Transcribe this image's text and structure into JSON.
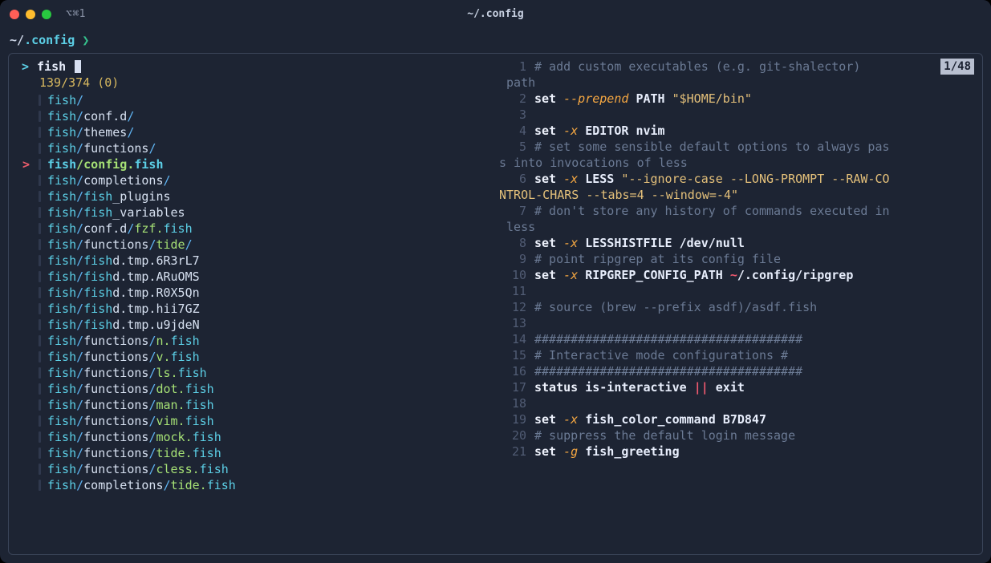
{
  "titlebar": {
    "tab_label": "⌥⌘1",
    "window_title": "~/.config"
  },
  "prompt": {
    "prefix": "~/",
    "dir": ".config",
    "symbol": "❯"
  },
  "fzf": {
    "query": "fish",
    "counts": "139/374 (0)",
    "preview_badge": "1/48",
    "selected_index": 4,
    "items": [
      [
        {
          "t": "fish",
          "c": "cyan"
        },
        {
          "t": "/",
          "c": "blue"
        }
      ],
      [
        {
          "t": "fish",
          "c": "cyan"
        },
        {
          "t": "/",
          "c": "blue"
        },
        {
          "t": "conf.d",
          "c": "text"
        },
        {
          "t": "/",
          "c": "blue"
        }
      ],
      [
        {
          "t": "fish",
          "c": "cyan"
        },
        {
          "t": "/",
          "c": "blue"
        },
        {
          "t": "themes",
          "c": "text"
        },
        {
          "t": "/",
          "c": "blue"
        }
      ],
      [
        {
          "t": "fish",
          "c": "cyan"
        },
        {
          "t": "/",
          "c": "blue"
        },
        {
          "t": "functions",
          "c": "text"
        },
        {
          "t": "/",
          "c": "blue"
        }
      ],
      [
        {
          "t": "fish",
          "c": "cyan"
        },
        {
          "t": "/",
          "c": "green"
        },
        {
          "t": "config.",
          "c": "green"
        },
        {
          "t": "fish",
          "c": "cyan"
        }
      ],
      [
        {
          "t": "fish",
          "c": "cyan"
        },
        {
          "t": "/",
          "c": "blue"
        },
        {
          "t": "completions",
          "c": "text"
        },
        {
          "t": "/",
          "c": "blue"
        }
      ],
      [
        {
          "t": "fish",
          "c": "cyan"
        },
        {
          "t": "/",
          "c": "blue"
        },
        {
          "t": "fish",
          "c": "cyan"
        },
        {
          "t": "_plugins",
          "c": "text"
        }
      ],
      [
        {
          "t": "fish",
          "c": "cyan"
        },
        {
          "t": "/",
          "c": "blue"
        },
        {
          "t": "fish",
          "c": "cyan"
        },
        {
          "t": "_variables",
          "c": "text"
        }
      ],
      [
        {
          "t": "fish",
          "c": "cyan"
        },
        {
          "t": "/",
          "c": "blue"
        },
        {
          "t": "conf.d",
          "c": "text"
        },
        {
          "t": "/",
          "c": "blue"
        },
        {
          "t": "fzf.",
          "c": "green"
        },
        {
          "t": "fish",
          "c": "cyan"
        }
      ],
      [
        {
          "t": "fish",
          "c": "cyan"
        },
        {
          "t": "/",
          "c": "blue"
        },
        {
          "t": "functions",
          "c": "text"
        },
        {
          "t": "/",
          "c": "blue"
        },
        {
          "t": "tide",
          "c": "green"
        },
        {
          "t": "/",
          "c": "blue"
        }
      ],
      [
        {
          "t": "fish",
          "c": "cyan"
        },
        {
          "t": "/",
          "c": "blue"
        },
        {
          "t": "fish",
          "c": "cyan"
        },
        {
          "t": "d.tmp.6R3rL7",
          "c": "text"
        }
      ],
      [
        {
          "t": "fish",
          "c": "cyan"
        },
        {
          "t": "/",
          "c": "blue"
        },
        {
          "t": "fish",
          "c": "cyan"
        },
        {
          "t": "d.tmp.ARuOMS",
          "c": "text"
        }
      ],
      [
        {
          "t": "fish",
          "c": "cyan"
        },
        {
          "t": "/",
          "c": "blue"
        },
        {
          "t": "fish",
          "c": "cyan"
        },
        {
          "t": "d.tmp.R0X5Qn",
          "c": "text"
        }
      ],
      [
        {
          "t": "fish",
          "c": "cyan"
        },
        {
          "t": "/",
          "c": "blue"
        },
        {
          "t": "fish",
          "c": "cyan"
        },
        {
          "t": "d.tmp.hii7GZ",
          "c": "text"
        }
      ],
      [
        {
          "t": "fish",
          "c": "cyan"
        },
        {
          "t": "/",
          "c": "blue"
        },
        {
          "t": "fish",
          "c": "cyan"
        },
        {
          "t": "d.tmp.u9jdeN",
          "c": "text"
        }
      ],
      [
        {
          "t": "fish",
          "c": "cyan"
        },
        {
          "t": "/",
          "c": "blue"
        },
        {
          "t": "functions",
          "c": "text"
        },
        {
          "t": "/",
          "c": "blue"
        },
        {
          "t": "n.",
          "c": "green"
        },
        {
          "t": "fish",
          "c": "cyan"
        }
      ],
      [
        {
          "t": "fish",
          "c": "cyan"
        },
        {
          "t": "/",
          "c": "blue"
        },
        {
          "t": "functions",
          "c": "text"
        },
        {
          "t": "/",
          "c": "blue"
        },
        {
          "t": "v.",
          "c": "green"
        },
        {
          "t": "fish",
          "c": "cyan"
        }
      ],
      [
        {
          "t": "fish",
          "c": "cyan"
        },
        {
          "t": "/",
          "c": "blue"
        },
        {
          "t": "functions",
          "c": "text"
        },
        {
          "t": "/",
          "c": "blue"
        },
        {
          "t": "ls.",
          "c": "green"
        },
        {
          "t": "fish",
          "c": "cyan"
        }
      ],
      [
        {
          "t": "fish",
          "c": "cyan"
        },
        {
          "t": "/",
          "c": "blue"
        },
        {
          "t": "functions",
          "c": "text"
        },
        {
          "t": "/",
          "c": "blue"
        },
        {
          "t": "dot.",
          "c": "green"
        },
        {
          "t": "fish",
          "c": "cyan"
        }
      ],
      [
        {
          "t": "fish",
          "c": "cyan"
        },
        {
          "t": "/",
          "c": "blue"
        },
        {
          "t": "functions",
          "c": "text"
        },
        {
          "t": "/",
          "c": "blue"
        },
        {
          "t": "man.",
          "c": "green"
        },
        {
          "t": "fish",
          "c": "cyan"
        }
      ],
      [
        {
          "t": "fish",
          "c": "cyan"
        },
        {
          "t": "/",
          "c": "blue"
        },
        {
          "t": "functions",
          "c": "text"
        },
        {
          "t": "/",
          "c": "blue"
        },
        {
          "t": "vim.",
          "c": "green"
        },
        {
          "t": "fish",
          "c": "cyan"
        }
      ],
      [
        {
          "t": "fish",
          "c": "cyan"
        },
        {
          "t": "/",
          "c": "blue"
        },
        {
          "t": "functions",
          "c": "text"
        },
        {
          "t": "/",
          "c": "blue"
        },
        {
          "t": "mock.",
          "c": "green"
        },
        {
          "t": "fish",
          "c": "cyan"
        }
      ],
      [
        {
          "t": "fish",
          "c": "cyan"
        },
        {
          "t": "/",
          "c": "blue"
        },
        {
          "t": "functions",
          "c": "text"
        },
        {
          "t": "/",
          "c": "blue"
        },
        {
          "t": "tide.",
          "c": "green"
        },
        {
          "t": "fish",
          "c": "cyan"
        }
      ],
      [
        {
          "t": "fish",
          "c": "cyan"
        },
        {
          "t": "/",
          "c": "blue"
        },
        {
          "t": "functions",
          "c": "text"
        },
        {
          "t": "/",
          "c": "blue"
        },
        {
          "t": "cless.",
          "c": "green"
        },
        {
          "t": "fish",
          "c": "cyan"
        }
      ],
      [
        {
          "t": "fish",
          "c": "cyan"
        },
        {
          "t": "/",
          "c": "blue"
        },
        {
          "t": "completions",
          "c": "text"
        },
        {
          "t": "/",
          "c": "blue"
        },
        {
          "t": "tide.",
          "c": "green"
        },
        {
          "t": "fish",
          "c": "cyan"
        }
      ]
    ],
    "preview": {
      "wraps": {
        "1": " path",
        "5": "s into invocations of less",
        "6": "NTROL-CHARS --tabs=4 --window=-4\"",
        "7": " less"
      },
      "lines": [
        {
          "n": 1,
          "tokens": [
            {
              "t": "# add custom executables (e.g. git-shalector)",
              "c": "comment"
            }
          ]
        },
        {
          "n": 2,
          "tokens": [
            {
              "t": "set",
              "c": "cmd"
            },
            {
              "t": " "
            },
            {
              "t": "--prepend",
              "c": "flag"
            },
            {
              "t": " "
            },
            {
              "t": "PATH",
              "c": "var"
            },
            {
              "t": " "
            },
            {
              "t": "\"$HOME",
              "c": "str"
            },
            {
              "t": "/bin",
              "c": "str"
            },
            {
              "t": "\"",
              "c": "str"
            }
          ]
        },
        {
          "n": 3,
          "tokens": []
        },
        {
          "n": 4,
          "tokens": [
            {
              "t": "set",
              "c": "cmd"
            },
            {
              "t": " "
            },
            {
              "t": "-x",
              "c": "flag"
            },
            {
              "t": " "
            },
            {
              "t": "EDITOR",
              "c": "var"
            },
            {
              "t": " "
            },
            {
              "t": "nvim",
              "c": "path"
            }
          ]
        },
        {
          "n": 5,
          "tokens": [
            {
              "t": "# set some sensible default options to always pas",
              "c": "comment"
            }
          ]
        },
        {
          "n": 6,
          "tokens": [
            {
              "t": "set",
              "c": "cmd"
            },
            {
              "t": " "
            },
            {
              "t": "-x",
              "c": "flag"
            },
            {
              "t": " "
            },
            {
              "t": "LESS",
              "c": "var"
            },
            {
              "t": " "
            },
            {
              "t": "\"--ignore-case --LONG-PROMPT --RAW-CO",
              "c": "str"
            }
          ]
        },
        {
          "n": 7,
          "tokens": [
            {
              "t": "# don't store any history of commands executed in",
              "c": "comment"
            }
          ]
        },
        {
          "n": 8,
          "tokens": [
            {
              "t": "set",
              "c": "cmd"
            },
            {
              "t": " "
            },
            {
              "t": "-x",
              "c": "flag"
            },
            {
              "t": " "
            },
            {
              "t": "LESSHISTFILE",
              "c": "var"
            },
            {
              "t": " "
            },
            {
              "t": "/dev/null",
              "c": "path"
            }
          ]
        },
        {
          "n": 9,
          "tokens": [
            {
              "t": "# point ripgrep at its config file",
              "c": "comment"
            }
          ]
        },
        {
          "n": 10,
          "tokens": [
            {
              "t": "set",
              "c": "cmd"
            },
            {
              "t": " "
            },
            {
              "t": "-x",
              "c": "flag"
            },
            {
              "t": " "
            },
            {
              "t": "RIPGREP_CONFIG_PATH",
              "c": "var"
            },
            {
              "t": " "
            },
            {
              "t": "~",
              "c": "tilde"
            },
            {
              "t": "/.config/ripgrep",
              "c": "path"
            }
          ]
        },
        {
          "n": 11,
          "tokens": []
        },
        {
          "n": 12,
          "tokens": [
            {
              "t": "# source (brew --prefix asdf)/asdf.fish",
              "c": "comment"
            }
          ]
        },
        {
          "n": 13,
          "tokens": []
        },
        {
          "n": 14,
          "tokens": [
            {
              "t": "#####################################",
              "c": "comment"
            }
          ]
        },
        {
          "n": 15,
          "tokens": [
            {
              "t": "# Interactive mode configurations #",
              "c": "comment"
            }
          ]
        },
        {
          "n": 16,
          "tokens": [
            {
              "t": "#####################################",
              "c": "comment"
            }
          ]
        },
        {
          "n": 17,
          "tokens": [
            {
              "t": "status",
              "c": "cmd"
            },
            {
              "t": " "
            },
            {
              "t": "is-interactive",
              "c": "kw"
            },
            {
              "t": " "
            },
            {
              "t": "||",
              "c": "op"
            },
            {
              "t": " "
            },
            {
              "t": "exit",
              "c": "kw"
            }
          ]
        },
        {
          "n": 18,
          "tokens": []
        },
        {
          "n": 19,
          "tokens": [
            {
              "t": "set",
              "c": "cmd"
            },
            {
              "t": " "
            },
            {
              "t": "-x",
              "c": "flag"
            },
            {
              "t": " "
            },
            {
              "t": "fish_color_command",
              "c": "var"
            },
            {
              "t": " "
            },
            {
              "t": "B7D847",
              "c": "num"
            }
          ]
        },
        {
          "n": 20,
          "tokens": [
            {
              "t": "# suppress the default login message",
              "c": "comment"
            }
          ]
        },
        {
          "n": 21,
          "tokens": [
            {
              "t": "set",
              "c": "cmd"
            },
            {
              "t": " "
            },
            {
              "t": "-g",
              "c": "flag"
            },
            {
              "t": " "
            },
            {
              "t": "fish_greeting",
              "c": "var"
            }
          ]
        }
      ]
    }
  }
}
